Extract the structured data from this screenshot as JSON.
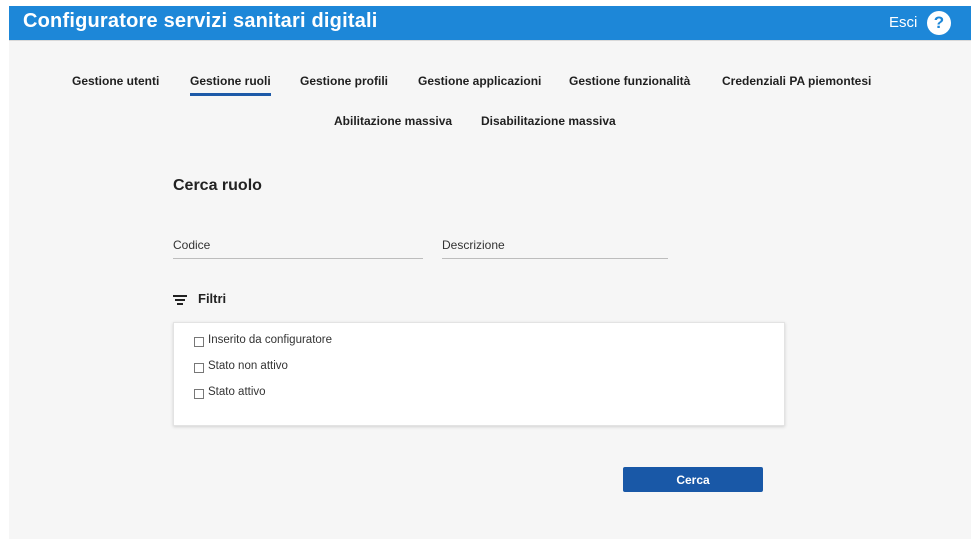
{
  "header": {
    "title": "Configuratore servizi sanitari digitali",
    "logout_label": "Esci",
    "help_label": "?"
  },
  "nav": {
    "row1": [
      {
        "label": "Gestione utenti"
      },
      {
        "label": "Gestione ruoli",
        "active": true
      },
      {
        "label": "Gestione profili"
      },
      {
        "label": "Gestione applicazioni"
      },
      {
        "label": "Gestione funzionalità"
      },
      {
        "label": "Credenziali PA piemontesi"
      }
    ],
    "row2": [
      {
        "label": "Abilitazione massiva"
      },
      {
        "label": "Disabilitazione massiva"
      }
    ]
  },
  "main": {
    "title": "Cerca ruolo",
    "fields": {
      "codice": {
        "placeholder": "Codice",
        "value": ""
      },
      "descrizione": {
        "placeholder": "Descrizione",
        "value": ""
      }
    },
    "filters": {
      "label": "Filtri",
      "options": [
        {
          "label": "Inserito da configuratore",
          "checked": false
        },
        {
          "label": "Stato non attivo",
          "checked": false
        },
        {
          "label": "Stato attivo",
          "checked": false
        }
      ]
    },
    "search_button": "Cerca"
  },
  "colors": {
    "header": "#1d87d8",
    "button": "#1958a7",
    "active_tab_underline": "#1d5aa8",
    "background": "#f6f6f6"
  },
  "icons": [
    "help-circle-icon",
    "filter-lines-icon",
    "checkbox-icon"
  ]
}
